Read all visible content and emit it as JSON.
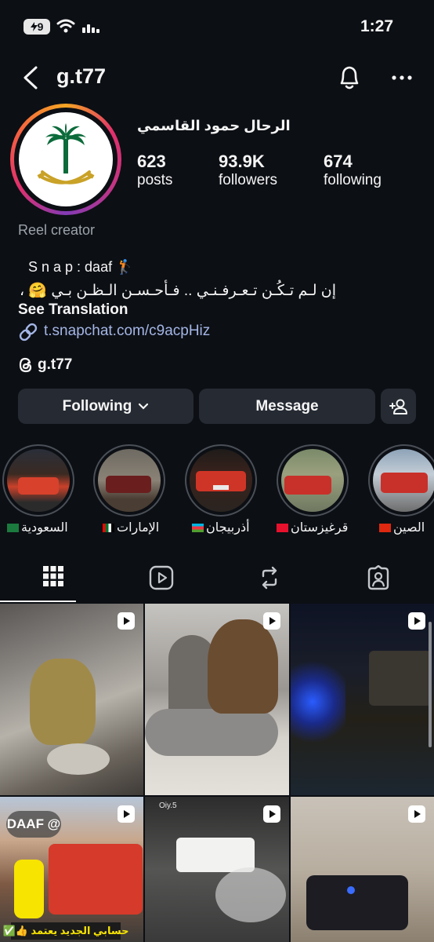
{
  "status": {
    "battery": "9",
    "time": "1:27"
  },
  "header": {
    "username": "g.t77"
  },
  "profile": {
    "full_name": "الرحال حمود القاسمي",
    "posts_count": "623",
    "posts_label": "posts",
    "followers_count": "93.9K",
    "followers_label": "followers",
    "following_count": "674",
    "following_label": "following",
    "category": "Reel creator",
    "bio_line1": "S n a p : daaf 🏌",
    "bio_line2": "إن لـم تـكُـن تـعـرفـنـي .. فـأحـسـن الـظـن بـي 🤗 ،",
    "see_translation": "See Translation",
    "link": "t.snapchat.com/c9acpHiz",
    "threads_handle": "g.t77"
  },
  "actions": {
    "following_label": "Following",
    "message_label": "Message"
  },
  "highlights": [
    {
      "label": "السعودية",
      "flag_color": "#1b7a3e"
    },
    {
      "label": "الإمارات",
      "flag_color": "#00732f"
    },
    {
      "label": "أذربيجان",
      "flag_color": "#00b5e2"
    },
    {
      "label": "قرغيزستان",
      "flag_color": "#e8112d"
    },
    {
      "label": "الصين",
      "flag_color": "#de2910"
    }
  ],
  "posts": {
    "cell4_overlay": "DAAF @",
    "cell4_caption": "حسابي الجديد يعتمد 👍✅",
    "cell5_tag": "Oiy.5"
  },
  "colors": {
    "background": "#0c0f14",
    "button": "#262b33",
    "link": "#a4b6e6",
    "muted": "#9ca3ab"
  }
}
